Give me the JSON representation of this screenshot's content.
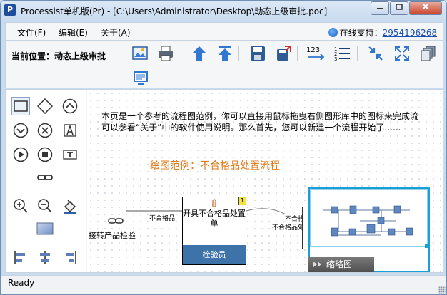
{
  "window": {
    "app_icon_letter": "P",
    "title": "Processist单机版(Pr) - [C:\\Users\\Administrator\\Desktop\\动态上级审批.poc]",
    "minimize_icon": "minimize-icon",
    "maximize_icon": "maximize-icon",
    "close_icon": "close-icon"
  },
  "menubar": {
    "items": [
      "文件(F)",
      "编辑(E)",
      "关于(A)"
    ],
    "support_label": "在线支持：",
    "support_number": "2954196268"
  },
  "toolbar": {
    "location": "当前位置：动态上级审批",
    "buttons": [
      "image-icon",
      "print-icon",
      "arrow-up-icon",
      "arrow-up-top-icon",
      "save-icon",
      "save-as-icon",
      "numbering-icon",
      "numbered-list-icon",
      "shrink-icon",
      "expand-icon",
      "copy-pages-icon",
      "monitor-icon"
    ],
    "numbering_label": "123"
  },
  "palette": {
    "tools": [
      "rectangle-tool-icon",
      "diamond-tool-icon",
      "up-circle-tool-icon",
      "down-circle-tool-icon",
      "x-circle-tool-icon",
      "text-a-tool-icon",
      "play-circle-tool-icon",
      "stop-circle-tool-icon",
      "text-t-tool-icon",
      "link-tool-icon",
      "zoom-in-icon",
      "zoom-out-icon",
      "fill-color-icon",
      "color-swatch-icon",
      "align-left-icon",
      "align-center-icon",
      "align-right-icon"
    ],
    "swatch_color": "#6f8fc6"
  },
  "canvas": {
    "intro_line1": "本页是一个参考的流程图范例，你可以直接用鼠标拖曳右侧图形库中的图标来完成流",
    "intro_line2": "可以参看“关于”中的软件使用说明。那么首先，您可以新建一个流程开始了......",
    "heading": "绘图范例：不合格品处置流程",
    "link_node_label": "接转产品检验",
    "edge1_label": "不合格品",
    "edge2_label_a": "不合格品",
    "edge2_label_b": "不合格品处置",
    "process_title": "开具不合格品处置单",
    "process_role": "检验员",
    "process_badge": "1",
    "accent_heading": "#e07a1b",
    "role_color": "#3d73a8"
  },
  "overview": {
    "tab_label": "缩略图"
  },
  "status": {
    "text": "Ready"
  }
}
